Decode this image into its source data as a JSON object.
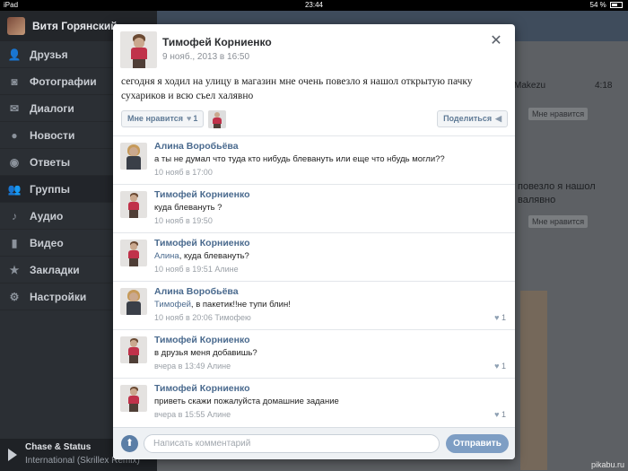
{
  "statusbar": {
    "device": "iPad",
    "time": "23:44",
    "battery": "54 %"
  },
  "sidebar": {
    "user_name": "Витя Горянский",
    "items": [
      {
        "label": "Друзья",
        "icon": "person-icon"
      },
      {
        "label": "Фотографии",
        "icon": "camera-icon"
      },
      {
        "label": "Диалоги",
        "icon": "chat-icon"
      },
      {
        "label": "Новости",
        "icon": "news-icon"
      },
      {
        "label": "Ответы",
        "icon": "reply-icon"
      },
      {
        "label": "Группы",
        "icon": "group-icon"
      },
      {
        "label": "Аудио",
        "icon": "music-icon"
      },
      {
        "label": "Видео",
        "icon": "video-icon"
      },
      {
        "label": "Закладки",
        "icon": "star-icon"
      },
      {
        "label": "Настройки",
        "icon": "gear-icon"
      }
    ],
    "player": {
      "track": "Chase & Status",
      "artist": "International (Skrillex Remix)"
    }
  },
  "background": {
    "snippet1": "Makezu",
    "time1": "4:18",
    "like_label": "Мне нравится",
    "snippet2": "повезло я нашол",
    "snippet3": "валявно"
  },
  "post": {
    "author": "Тимофей Корниенко",
    "date": "9 нояб., 2013 в 16:50",
    "text": "сегодня я ходил на улицу в магазин мне очень повезло я нашол открытую пачку сухариков и всю съел халявно",
    "like_label": "Мне нравится",
    "like_count": "1",
    "share_label": "Поделиться"
  },
  "comments": [
    {
      "author": "Алина Воробьёва",
      "reply_to": "",
      "text": "а ты не думал что туда кто нибудь блевануть или еще что нбудь могли??",
      "meta": "10 нояб в 17:00",
      "likes": "",
      "avatar": "girl"
    },
    {
      "author": "Тимофей Корниенко",
      "reply_to": "",
      "text": "куда блевануть ?",
      "meta": "10 нояб в 19:50",
      "likes": "",
      "avatar": "boy"
    },
    {
      "author": "Тимофей Корниенко",
      "reply_to": "Алина",
      "text": ", куда блевануть?",
      "meta": "10 нояб в 19:51 Алине",
      "likes": "",
      "avatar": "boy"
    },
    {
      "author": "Алина Воробьёва",
      "reply_to": "Тимофей",
      "text": ", в пакетик!!не тупи блин!",
      "meta": "10 нояб в 20:06 Тимофею",
      "likes": "1",
      "avatar": "girl"
    },
    {
      "author": "Тимофей Корниенко",
      "reply_to": "",
      "text": "в друзья меня добавишь?",
      "meta": "вчера в 13:49 Алине",
      "likes": "1",
      "avatar": "boy"
    },
    {
      "author": "Тимофей Корниенко",
      "reply_to": "",
      "text": "приветь скажи пожалуйста домашние задание",
      "meta": "вчера в 15:55 Алине",
      "likes": "1",
      "avatar": "boy"
    }
  ],
  "composer": {
    "placeholder": "Написать комментарий",
    "send_label": "Отправить"
  },
  "watermark": "pikabu.ru",
  "colors": {
    "accent": "#4a6a8e",
    "send_button": "#7e9ec4",
    "sidebar": "#2b2f34"
  }
}
